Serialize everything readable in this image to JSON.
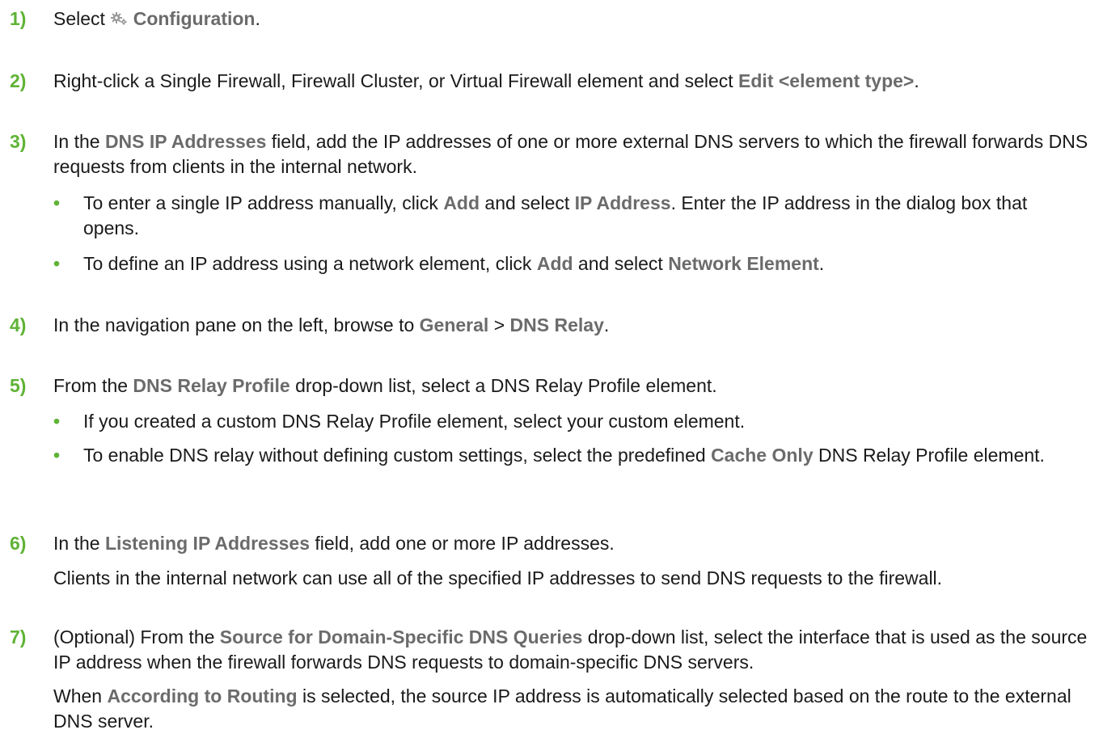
{
  "colors": {
    "accent": "#5fb336",
    "ui_term": "#6b6b6b",
    "text": "#1a1a1a"
  },
  "steps": [
    {
      "num": "1)",
      "a": "Select ",
      "icon": "gear-icon",
      "b": "Configuration",
      "c": "."
    },
    {
      "num": "2)",
      "a": "Right-click a Single Firewall, Firewall Cluster, or Virtual Firewall element and select ",
      "b": "Edit <element type>",
      "c": "."
    },
    {
      "num": "3)",
      "a": "In the ",
      "b": "DNS IP Addresses",
      "c": " field, add the IP addresses of one or more external DNS servers to which the firewall forwards DNS requests from clients in the internal network.",
      "bullets": [
        {
          "a": "To enter a single IP address manually, click ",
          "b": "Add",
          "c": " and select ",
          "d": "IP Address",
          "e": ". Enter the IP address in the dialog box that opens."
        },
        {
          "a": "To define an IP address using a network element, click ",
          "b": "Add",
          "c": " and select ",
          "d": "Network Element",
          "e": "."
        }
      ]
    },
    {
      "num": "4)",
      "a": "In the navigation pane on the left, browse to ",
      "b": "General",
      "c": " > ",
      "d": "DNS Relay",
      "e": "."
    },
    {
      "num": "5)",
      "a": "From the ",
      "b": "DNS Relay Profile",
      "c": " drop-down list, select a DNS Relay Profile element.",
      "bullets": [
        {
          "a": "If you created a custom DNS Relay Profile element, select your custom element."
        },
        {
          "a": "To enable DNS relay without defining custom settings, select the predefined ",
          "b": "Cache Only",
          "c": " DNS Relay Profile element."
        }
      ]
    },
    {
      "num": "6)",
      "a": "In the ",
      "b": "Listening IP Addresses",
      "c": " field, add one or more IP addresses.",
      "note": "Clients in the internal network can use all of the specified IP addresses to send DNS requests to the firewall."
    },
    {
      "num": "7)",
      "a": "(Optional) From the ",
      "b": "Source for Domain-Specific DNS Queries",
      "c": " drop-down list, select the interface that is used as the source IP address when the firewall forwards DNS requests to domain-specific DNS servers.",
      "note_a": "When ",
      "note_b": "According to Routing",
      "note_c": " is selected, the source IP address is automatically selected based on the route to the external DNS server."
    }
  ]
}
